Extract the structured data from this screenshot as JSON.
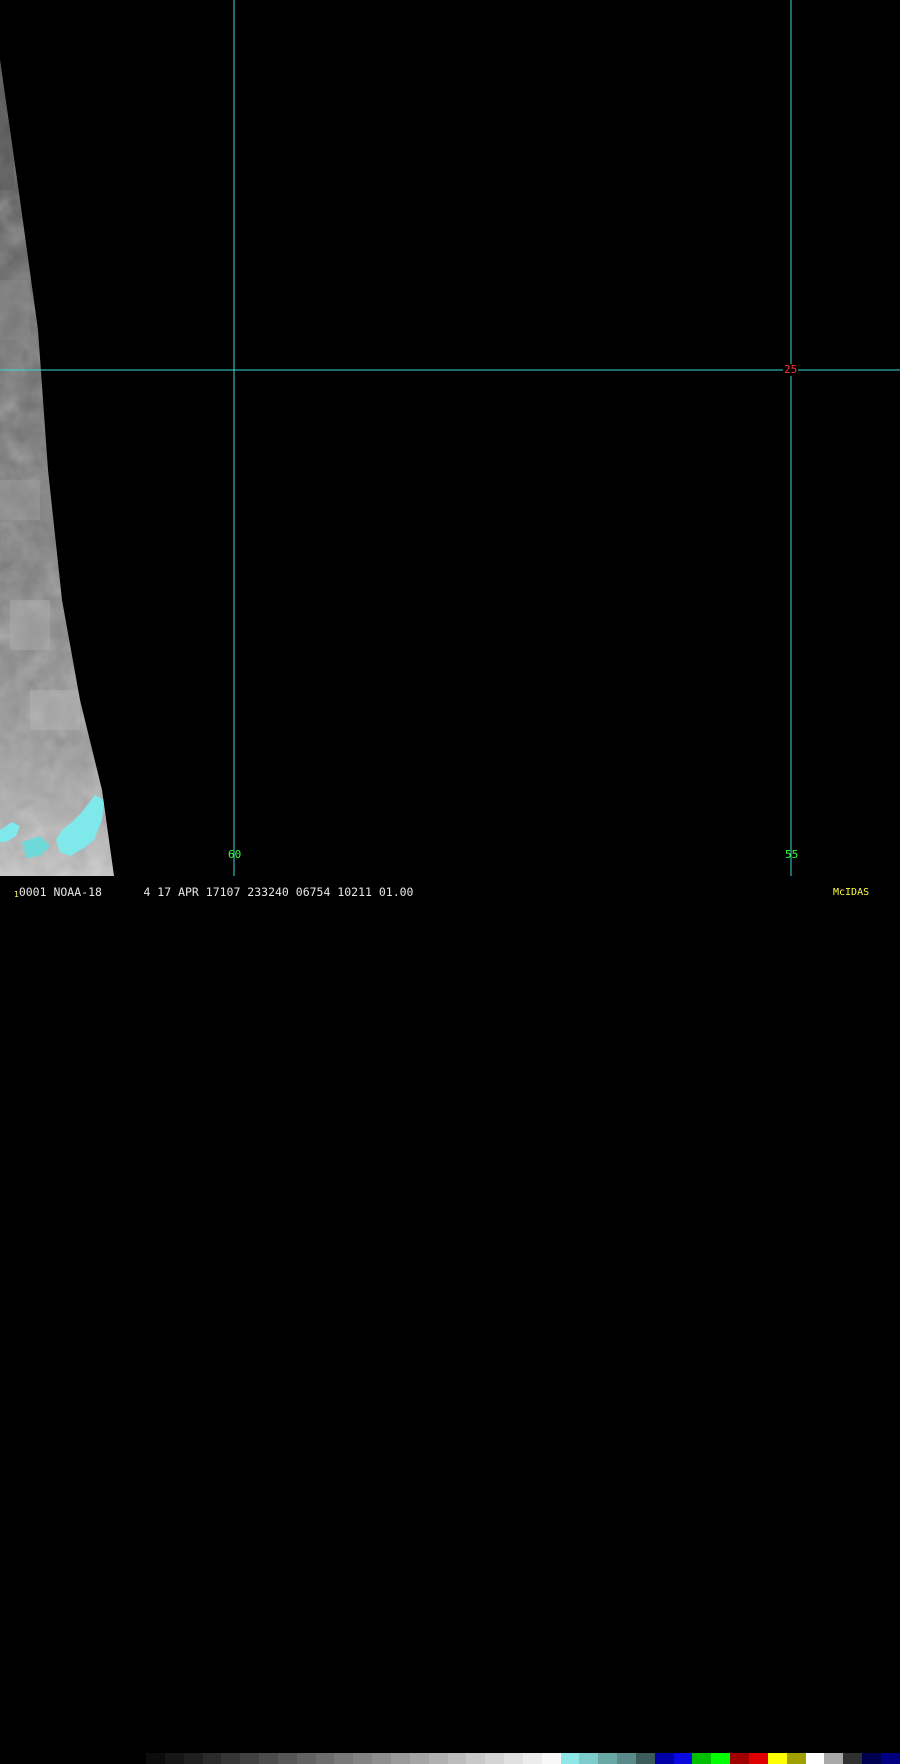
{
  "header": {
    "frame_index": "1",
    "info_text": "0001 NOAA-18      4 17 APR 17107 233240 06754 10211 01.00",
    "software": "McIDAS"
  },
  "grid": {
    "latitude_label": "25",
    "longitude_labels": [
      "60",
      "55"
    ],
    "line_color": "#3ad8d8"
  },
  "colorbar": {
    "colors": [
      "#0c0c0c",
      "#161616",
      "#202020",
      "#2b2b2b",
      "#363636",
      "#414141",
      "#4c4c4c",
      "#575757",
      "#626262",
      "#6d6d6d",
      "#787878",
      "#838383",
      "#8e8e8e",
      "#999999",
      "#a4a4a4",
      "#b0b0b0",
      "#bcbcbc",
      "#c8c8c8",
      "#d4d4d4",
      "#e0e0e0",
      "#ececec",
      "#f8f8f8",
      "#8fe8e8",
      "#7ccccc",
      "#6aa8a8",
      "#5a8a8a",
      "#3c5c5c",
      "#0000a8",
      "#0a0ae0",
      "#00c000",
      "#00ff00",
      "#a00000",
      "#e00000",
      "#ffff00",
      "#a0a000",
      "#ffffff",
      "#a8a8a8",
      "#303030",
      "#000050",
      "#000080"
    ]
  }
}
